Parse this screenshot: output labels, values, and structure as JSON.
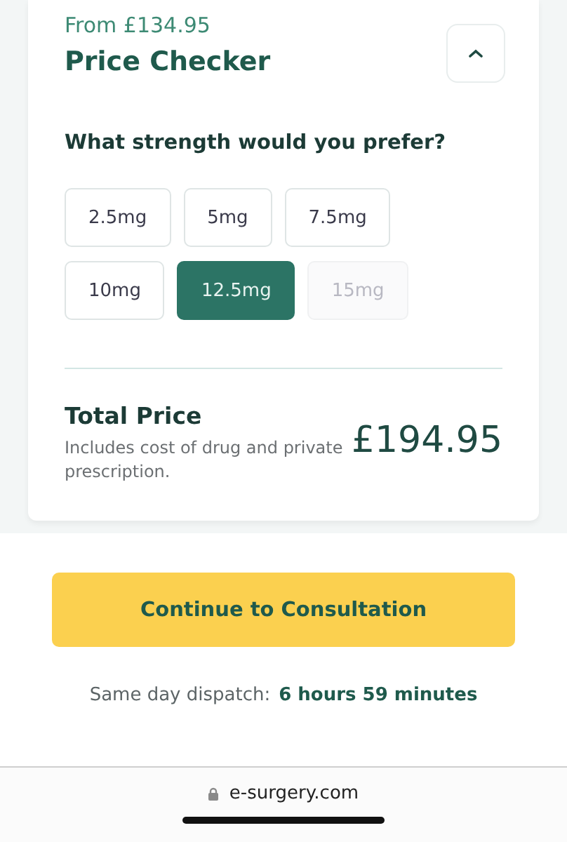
{
  "price_checker": {
    "from_price": "From £134.95",
    "title": "Price Checker",
    "expanded": true,
    "question": "What strength would you prefer?",
    "options": [
      {
        "label": "2.5mg",
        "selected": false,
        "disabled": false
      },
      {
        "label": "5mg",
        "selected": false,
        "disabled": false
      },
      {
        "label": "7.5mg",
        "selected": false,
        "disabled": false
      },
      {
        "label": "10mg",
        "selected": false,
        "disabled": false
      },
      {
        "label": "12.5mg",
        "selected": true,
        "disabled": false
      },
      {
        "label": "15mg",
        "selected": false,
        "disabled": true
      }
    ],
    "total_label": "Total Price",
    "total_note": "Includes cost of drug and private prescription.",
    "total_price": "£194.95"
  },
  "cta": {
    "label": "Continue to Consultation"
  },
  "dispatch": {
    "label": "Same day dispatch:",
    "time": "6 hours 59 minutes"
  },
  "browser_bar": {
    "url": "e-surgery.com"
  }
}
